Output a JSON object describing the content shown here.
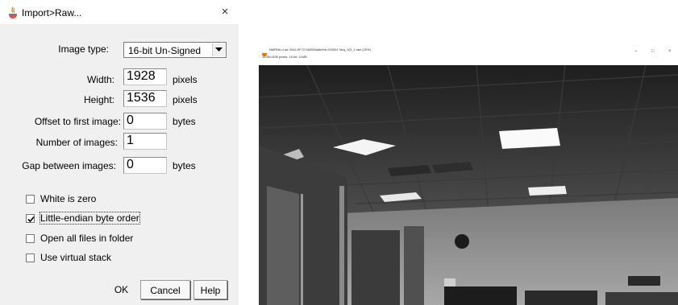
{
  "dialog": {
    "title": "Import>Raw...",
    "close_glyph": "×",
    "image_type": {
      "label": "Image type:",
      "value": "16-bit Un-Signed"
    },
    "fields": [
      {
        "label": "Width:",
        "value": "1928",
        "unit": "pixels"
      },
      {
        "label": "Height:",
        "value": "1536",
        "unit": "pixels"
      },
      {
        "label": "Offset to first image:",
        "value": "0",
        "unit": "bytes"
      },
      {
        "label": "Number of images:",
        "value": "1",
        "unit": ""
      },
      {
        "label": "Gap between images:",
        "value": "0",
        "unit": "bytes"
      }
    ],
    "checkboxes": [
      {
        "label": "White is zero",
        "checked": false
      },
      {
        "label": "Little-endian byte order",
        "checked": true
      },
      {
        "label": "Open all files in folder",
        "checked": false
      },
      {
        "label": "Use virtual stack",
        "checked": false
      }
    ],
    "buttons": {
      "ok": "OK",
      "cancel": "Cancel",
      "help": "Help"
    },
    "icons": {
      "app": "java-cup-icon",
      "dropdown": "chevron-down-icon"
    }
  },
  "image_window": {
    "title": "NMRNb-d ae-4344-9F72-9A5D8a6bbbb-000001 Neq_0(0_1.raw (25%)",
    "info": "1928x1536 pixels; 16-bit; 11MB",
    "controls": {
      "minimize": "–",
      "maximize": "□",
      "close": "×"
    }
  },
  "colors": {
    "dialog_bg": "#f0f0f0",
    "title_bg": "#ffffff",
    "java_icon": "#e07b00"
  }
}
